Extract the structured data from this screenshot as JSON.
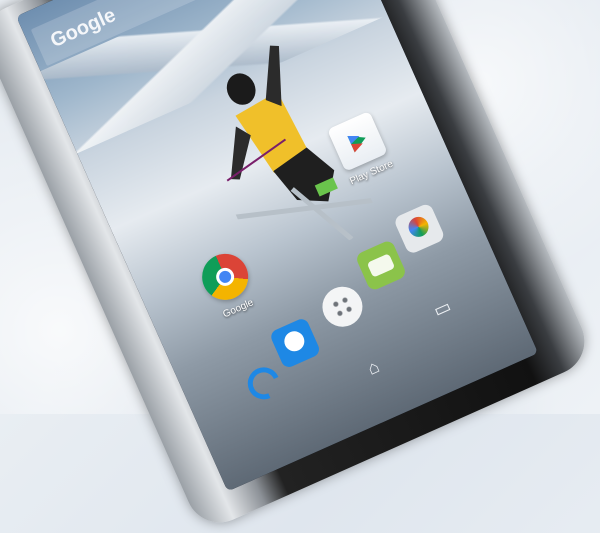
{
  "google_search": {
    "label": "Google"
  },
  "desktop_icons": [
    {
      "id": "play-store",
      "label": "Play Store"
    },
    {
      "id": "google-chrome",
      "label": "Google"
    }
  ],
  "dock": {
    "items": [
      "phone",
      "contacts",
      "apps",
      "messaging",
      "camera"
    ]
  },
  "navbar": {
    "back_symbol": "⌂",
    "recents_symbol": "▭"
  },
  "colors": {
    "chrome_red": "#db4437",
    "chrome_yellow": "#f4b400",
    "chrome_green": "#0f9d58",
    "chrome_blue": "#4285f4",
    "skier_jacket": "#f0c02a",
    "play_store_bag": "#f7f7f7",
    "messaging_green": "#8bc34a",
    "phone_blue": "#1e88e5"
  }
}
